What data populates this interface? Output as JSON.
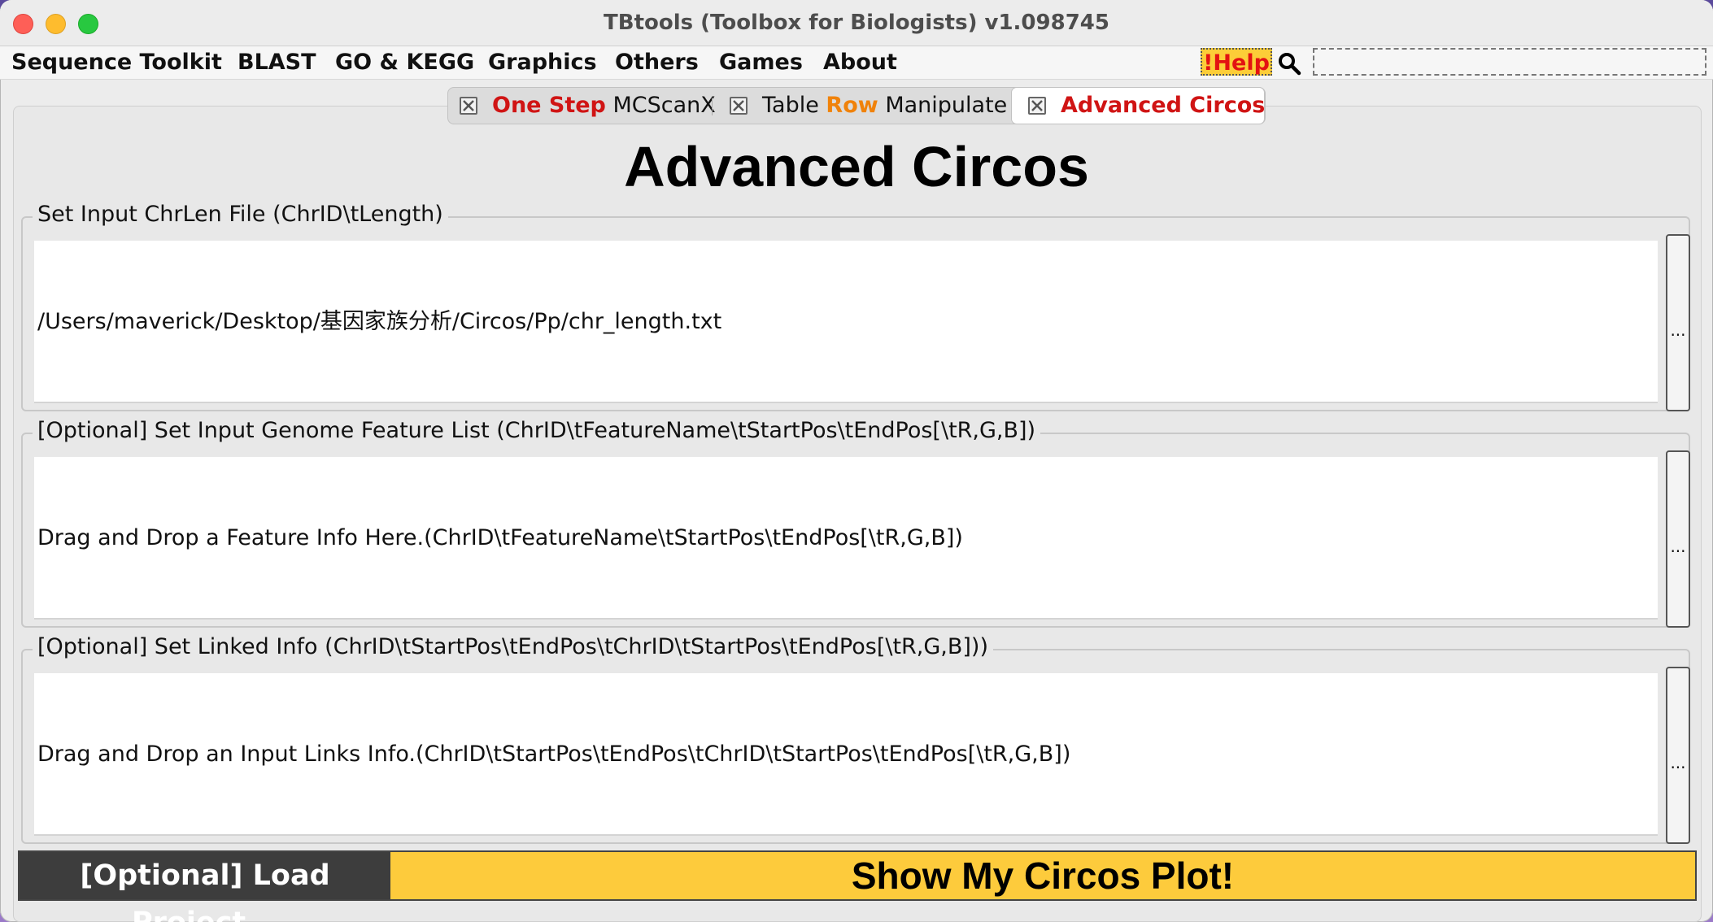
{
  "window": {
    "title": "TBtools (Toolbox for Biologists) v1.098745"
  },
  "menu": {
    "items": [
      {
        "label": "Sequence Toolkit"
      },
      {
        "label": "BLAST"
      },
      {
        "label": "GO & KEGG"
      },
      {
        "label": "Graphics"
      },
      {
        "label": "Others"
      },
      {
        "label": "Games"
      },
      {
        "label": "About"
      }
    ],
    "help_label": "!Help"
  },
  "tabs": {
    "one_step": {
      "part1": "One Step",
      "part2": "MCScanX"
    },
    "table_row": {
      "part1": "Table",
      "part2": "Row",
      "part3": "Manipulate"
    },
    "advanced": {
      "label": "Advanced Circos"
    }
  },
  "page": {
    "heading": "Advanced Circos"
  },
  "groups": {
    "chrlen": {
      "legend": "Set Input ChrLen File (ChrID\\tLength)",
      "value": "/Users/maverick/Desktop/基因家族分析/Circos/Pp/chr_length.txt",
      "browse": "..."
    },
    "feature": {
      "legend": "[Optional] Set Input Genome Feature List (ChrID\\tFeatureName\\tStartPos\\tEndPos[\\tR,G,B])",
      "value": "Drag and Drop a Feature Info Here.(ChrID\\tFeatureName\\tStartPos\\tEndPos[\\tR,G,B])",
      "browse": "..."
    },
    "links": {
      "legend": "[Optional] Set Linked Info (ChrID\\tStartPos\\tEndPos\\tChrID\\tStartPos\\tEndPos[\\tR,G,B]))",
      "value": "Drag and Drop an Input Links Info.(ChrID\\tStartPos\\tEndPos\\tChrID\\tStartPos\\tEndPos[\\tR,G,B])",
      "browse": "..."
    }
  },
  "actions": {
    "load_project": "[Optional] Load Project...",
    "show_plot": "Show My Circos Plot!"
  },
  "colors": {
    "accent_red": "#d01414",
    "accent_orange": "#f0820a",
    "action_yellow": "#fdcb3c",
    "load_dark": "#3d3d3d"
  },
  "icons": {
    "search": "search-icon",
    "tab_close": "close-icon"
  }
}
